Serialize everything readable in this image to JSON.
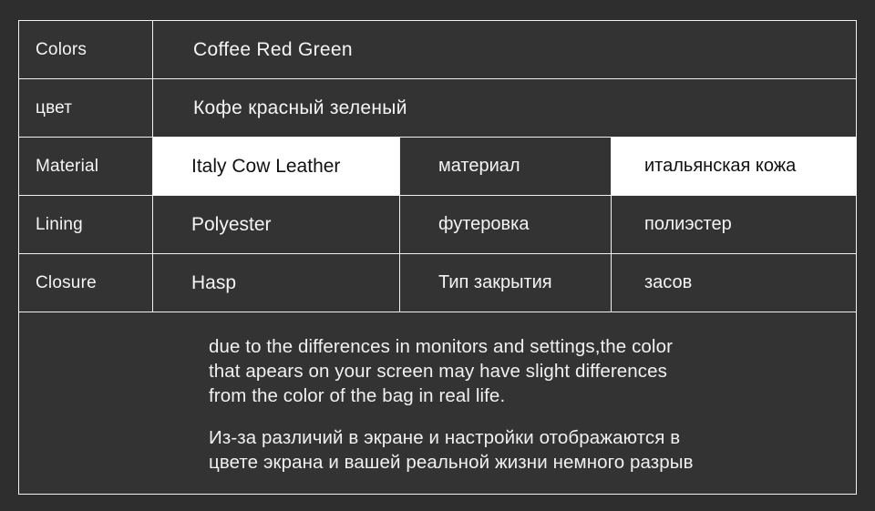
{
  "colors": {
    "page_background": "#2e2e2e",
    "cell_background": "#333333",
    "border": "#f2f2f2",
    "text": "#f4f4f4",
    "highlight_background": "#ffffff",
    "highlight_text": "#111111"
  },
  "table": {
    "rows": [
      {
        "label": "Colors",
        "value": "Coffee   Red   Green",
        "layout": "wide",
        "highlight": false
      },
      {
        "label": "цвет",
        "value": "Кофе  красный  зеленый",
        "layout": "wide",
        "highlight": false
      },
      {
        "label": "Material",
        "value_en": "Italy Cow Leather",
        "label_ru": "материал",
        "value_ru": "итальянская кожа",
        "layout": "split",
        "highlight_en": true,
        "highlight_ru": true
      },
      {
        "label": "Lining",
        "value_en": "Polyester",
        "label_ru": "футеровка",
        "value_ru": "полиэстер",
        "layout": "split",
        "highlight_en": false,
        "highlight_ru": false
      },
      {
        "label": "Closure",
        "value_en": "Hasp",
        "label_ru": "Тип закрытия",
        "value_ru": "засов",
        "layout": "split",
        "highlight_en": false,
        "highlight_ru": false
      }
    ]
  },
  "note": {
    "english_line_1": "due to the differences in monitors and settings,the color",
    "english_line_2": "that apears on your screen may have slight differences",
    "english_line_3": "from the color of the bag in real life.",
    "russian_line_1": "Из-за различий в экране и настройки отображаются в",
    "russian_line_2": "цвете экрана и вашей реальной жизни немного разрыв"
  }
}
